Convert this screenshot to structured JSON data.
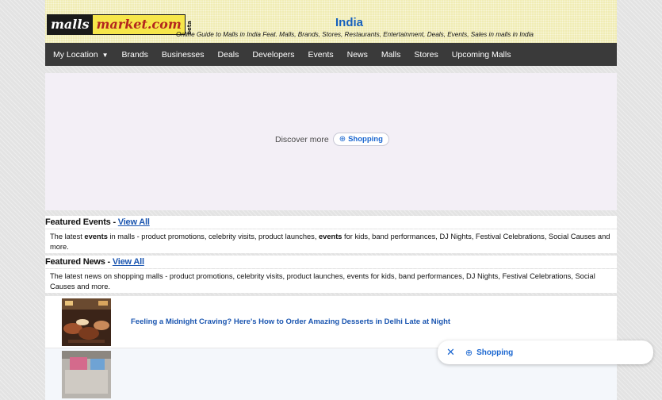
{
  "header": {
    "logo": {
      "part1": "malls",
      "part2": "market.com",
      "badge": "beta"
    },
    "title": "India",
    "tagline": "Online Guide to Malls in India Feat. Malls, Brands, Stores, Restaurants, Entertainment, Deals, Events, Sales in malls in India"
  },
  "nav": {
    "items": [
      "My Location",
      "Brands",
      "Businesses",
      "Deals",
      "Developers",
      "Events",
      "News",
      "Malls",
      "Stores",
      "Upcoming Malls"
    ]
  },
  "ad": {
    "discover_label": "Discover more",
    "chip_label": "Shopping"
  },
  "featured_events": {
    "heading": "Featured Events - ",
    "view_all": "View All",
    "desc_1": "The latest ",
    "desc_bold_1": "events",
    "desc_2": " in malls - product promotions, celebrity visits, product launches, ",
    "desc_bold_2": "events",
    "desc_3": " for kids, band performances, DJ Nights, Festival Celebrations, Social Causes and more."
  },
  "featured_news": {
    "heading": "Featured News - ",
    "view_all": "View All",
    "desc": "The latest news on shopping malls - product promotions, celebrity visits, product launches, events for kids, band performances, DJ Nights, Festival Celebrations, Social Causes and more.",
    "items": [
      {
        "title": "Feeling a Midnight Craving? Here's How to Order Amazing Desserts in Delhi Late at Night"
      },
      {
        "title": ""
      }
    ]
  },
  "toast": {
    "label": "Shopping"
  }
}
